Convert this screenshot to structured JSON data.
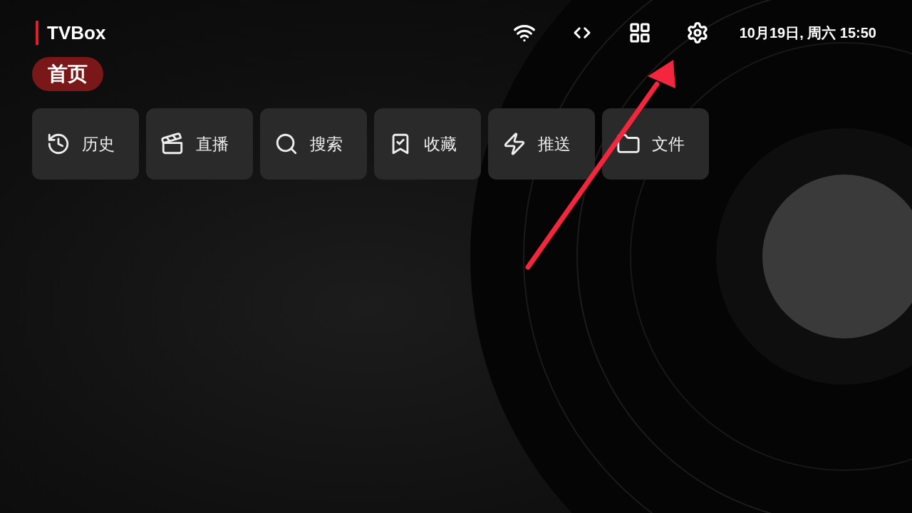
{
  "app": {
    "title": "TVBox"
  },
  "status": {
    "datetime": "10月19日, 周六 15:50"
  },
  "tabs": [
    {
      "label": "首页",
      "selected": true
    }
  ],
  "shortcuts": [
    {
      "label": "历史"
    },
    {
      "label": "直播"
    },
    {
      "label": "搜索"
    },
    {
      "label": "收藏"
    },
    {
      "label": "推送"
    },
    {
      "label": "文件"
    }
  ]
}
